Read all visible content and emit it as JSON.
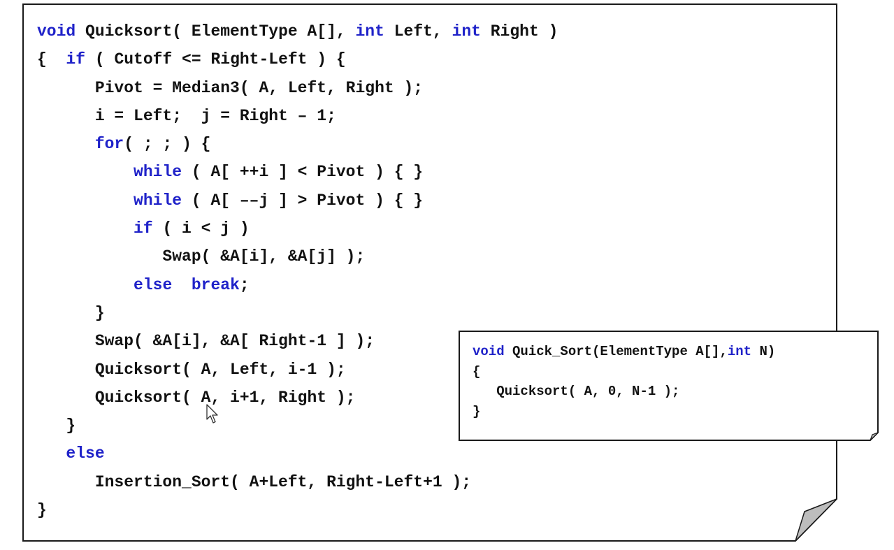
{
  "main_listing": {
    "lines": [
      [
        {
          "k": true,
          "t": "void"
        },
        {
          "k": false,
          "t": " Quicksort( ElementType A[], "
        },
        {
          "k": true,
          "t": "int"
        },
        {
          "k": false,
          "t": " Left, "
        },
        {
          "k": true,
          "t": "int"
        },
        {
          "k": false,
          "t": " Right )"
        }
      ],
      [
        {
          "k": false,
          "t": "{  "
        },
        {
          "k": true,
          "t": "if"
        },
        {
          "k": false,
          "t": " ( Cutoff <= Right-Left ) {"
        }
      ],
      [
        {
          "k": false,
          "t": "      Pivot = Median3( A, Left, Right );"
        }
      ],
      [
        {
          "k": false,
          "t": "      i = Left;  j = Right – 1;"
        }
      ],
      [
        {
          "k": false,
          "t": "      "
        },
        {
          "k": true,
          "t": "for"
        },
        {
          "k": false,
          "t": "( ; ; ) {"
        }
      ],
      [
        {
          "k": false,
          "t": "          "
        },
        {
          "k": true,
          "t": "while"
        },
        {
          "k": false,
          "t": " ( A[ ++i ] < Pivot ) { }"
        }
      ],
      [
        {
          "k": false,
          "t": "          "
        },
        {
          "k": true,
          "t": "while"
        },
        {
          "k": false,
          "t": " ( A[ ––j ] > Pivot ) { }"
        }
      ],
      [
        {
          "k": false,
          "t": "          "
        },
        {
          "k": true,
          "t": "if"
        },
        {
          "k": false,
          "t": " ( i < j )"
        }
      ],
      [
        {
          "k": false,
          "t": "             Swap( &A[i], &A[j] );"
        }
      ],
      [
        {
          "k": false,
          "t": "          "
        },
        {
          "k": true,
          "t": "else"
        },
        {
          "k": false,
          "t": "  "
        },
        {
          "k": true,
          "t": "break"
        },
        {
          "k": false,
          "t": ";"
        }
      ],
      [
        {
          "k": false,
          "t": "      }"
        }
      ],
      [
        {
          "k": false,
          "t": "      Swap( &A[i], &A[ Right-1 ] );"
        }
      ],
      [
        {
          "k": false,
          "t": "      Quicksort( A, Left, i-1 );"
        }
      ],
      [
        {
          "k": false,
          "t": "      Quicksort( A, i+1, Right );"
        }
      ],
      [
        {
          "k": false,
          "t": "   }"
        }
      ],
      [
        {
          "k": false,
          "t": "   "
        },
        {
          "k": true,
          "t": "else"
        }
      ],
      [
        {
          "k": false,
          "t": "      Insertion_Sort( A+Left, Right-Left+1 );"
        }
      ],
      [
        {
          "k": false,
          "t": "}"
        }
      ]
    ]
  },
  "side_listing": {
    "lines": [
      [
        {
          "k": true,
          "t": "void"
        },
        {
          "k": false,
          "t": " Quick_Sort(ElementType A[],"
        },
        {
          "k": true,
          "t": "int"
        },
        {
          "k": false,
          "t": " N)"
        }
      ],
      [
        {
          "k": false,
          "t": "{"
        }
      ],
      [
        {
          "k": false,
          "t": "   Quicksort( A, 0, N-1 );"
        }
      ],
      [
        {
          "k": false,
          "t": "}"
        }
      ]
    ]
  },
  "colors": {
    "keyword": "#1f22c9",
    "text": "#111111",
    "page_border": "#1a1a1a",
    "fold": "#bdbdbd"
  },
  "icons": {
    "cursor": "mouse-pointer-icon"
  }
}
